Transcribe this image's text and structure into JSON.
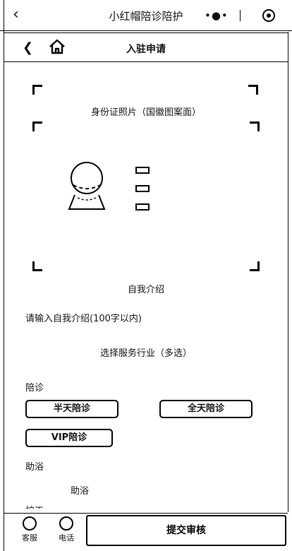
{
  "topbar": {
    "back_icon": "chevron-left-icon",
    "title": "小红帽陪诊陪护",
    "more_icon": "dots-icon",
    "close_icon": "target-icon"
  },
  "subheader": {
    "back_icon": "back-icon",
    "home_icon": "home-icon",
    "title": "入驻申请"
  },
  "photo": {
    "label": "身份证照片（国徽图案面）"
  },
  "intro": {
    "title": "自我介绍",
    "placeholder": "请输入自我介绍(100字以内)"
  },
  "services": {
    "title": "选择服务行业（多选）",
    "groups": [
      {
        "label": "陪诊",
        "options": [
          "半天陪诊",
          "全天陪诊",
          "VIP陪诊"
        ]
      },
      {
        "label": "助浴",
        "options": [
          "助浴"
        ]
      },
      {
        "label": "护工"
      }
    ]
  },
  "bottombar": {
    "tabs": [
      {
        "label": "客服",
        "icon": "customer-service-icon"
      },
      {
        "label": "电话",
        "icon": "phone-icon"
      }
    ],
    "submit_label": "提交审核"
  }
}
